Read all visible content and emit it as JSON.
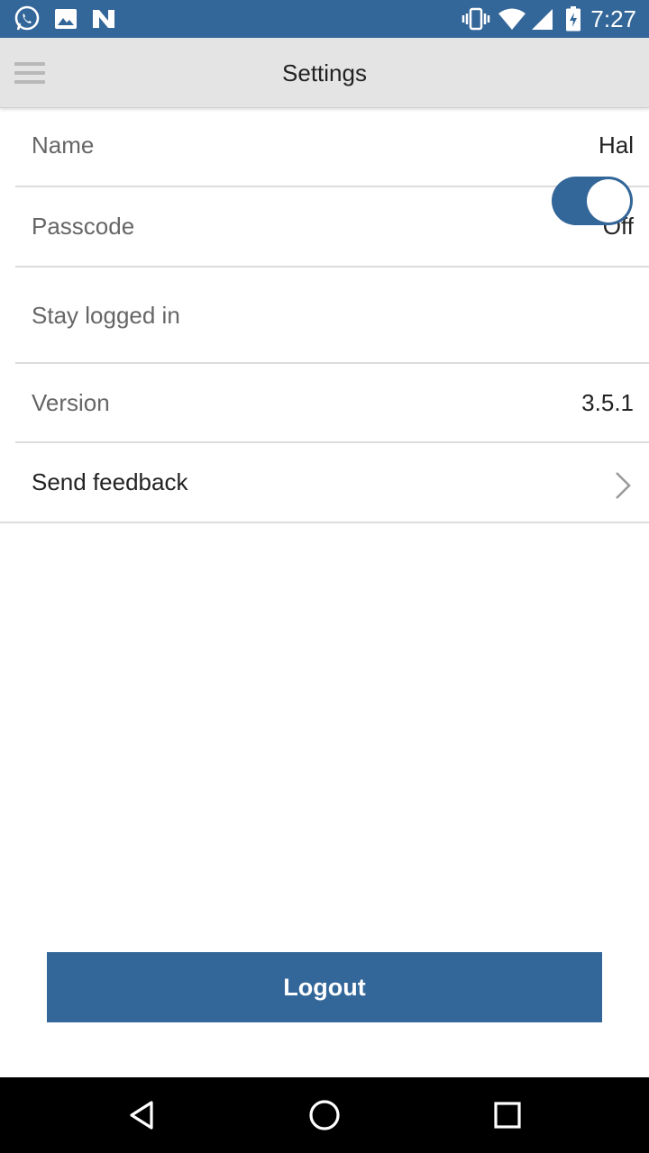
{
  "status_bar": {
    "time": "7:27",
    "color": "#336699",
    "left_icons": [
      "whatsapp-icon",
      "image-icon",
      "n-app-icon"
    ],
    "right_icons": [
      "vibrate-icon",
      "wifi-icon",
      "signal-icon",
      "battery-charging-icon"
    ]
  },
  "app_bar": {
    "title": "Settings",
    "menu_icon": "hamburger-menu-icon"
  },
  "settings": {
    "name": {
      "label": "Name",
      "value": "Hal"
    },
    "passcode": {
      "label": "Passcode",
      "value": "Off"
    },
    "stay_logged_in": {
      "label": "Stay logged in",
      "enabled": true
    },
    "version": {
      "label": "Version",
      "value": "3.5.1"
    },
    "send_feedback": {
      "label": "Send feedback",
      "icon": "chevron-right-icon"
    }
  },
  "logout": {
    "label": "Logout",
    "color": "#336699"
  },
  "nav_bar": {
    "icons": [
      "back-icon",
      "home-icon",
      "recents-icon"
    ]
  }
}
